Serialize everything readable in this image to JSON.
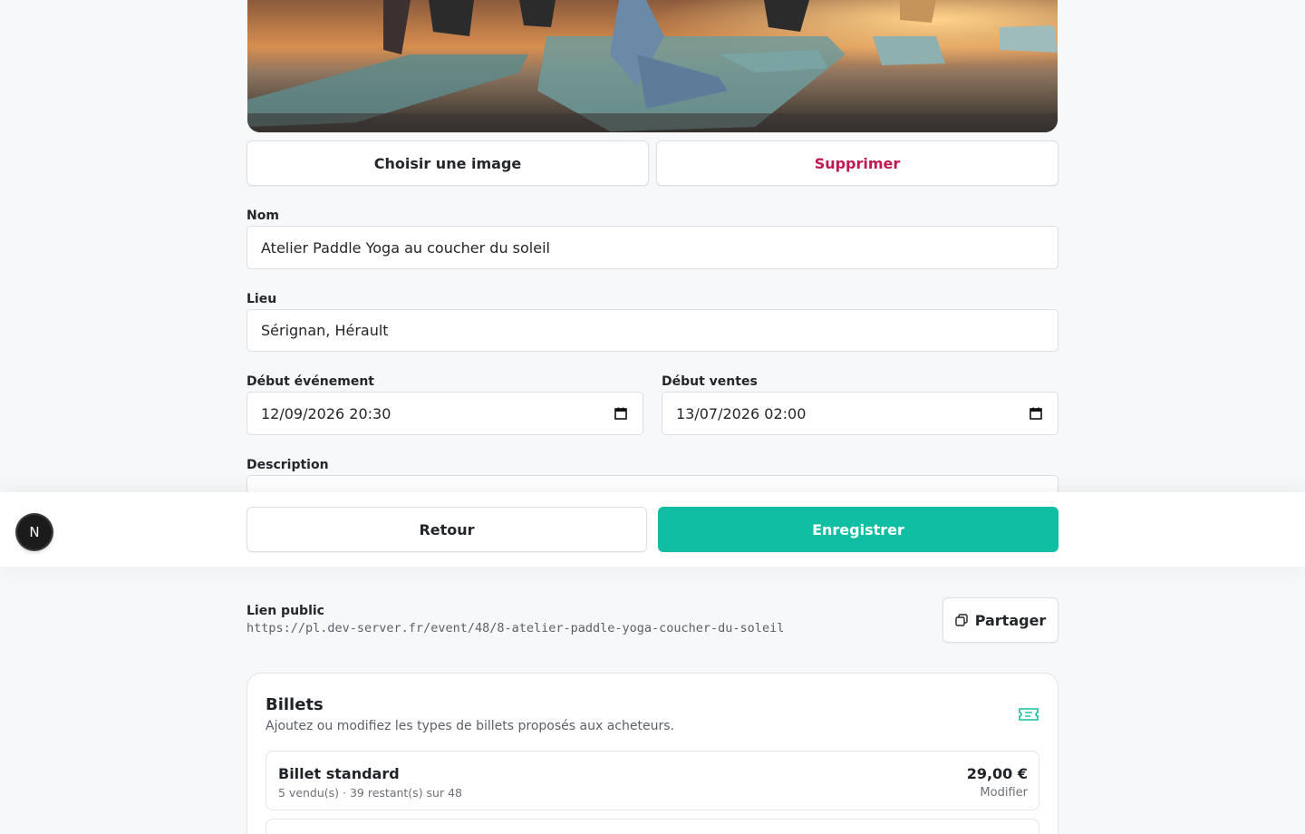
{
  "image_section": {
    "choose_label": "Choisir une image",
    "delete_label": "Supprimer"
  },
  "form": {
    "name_label": "Nom",
    "name_value": "Atelier Paddle Yoga au coucher du soleil",
    "place_label": "Lieu",
    "place_value": "Sérignan, Hérault",
    "event_start_label": "Début événement",
    "event_start_value": "12/09/2026 20:30",
    "sales_start_label": "Début ventes",
    "sales_start_value": "13/07/2026 02:00",
    "description_label": "Description"
  },
  "actions": {
    "back_label": "Retour",
    "save_label": "Enregistrer",
    "badge_letter": "N"
  },
  "public_link": {
    "label": "Lien public",
    "url": "https://pl.dev-server.fr/event/48/8-atelier-paddle-yoga-coucher-du-soleil",
    "share_label": "Partager"
  },
  "tickets": {
    "title": "Billets",
    "subtitle": "Ajoutez ou modifiez les types de billets proposés aux acheteurs.",
    "items": [
      {
        "name": "Billet standard",
        "meta": "5 vendu(s) · 39 restant(s) sur 48",
        "price": "29,00 €",
        "edit_label": "Modifier"
      }
    ]
  },
  "colors": {
    "accent": "#10bfa3",
    "danger": "#c0184f"
  }
}
